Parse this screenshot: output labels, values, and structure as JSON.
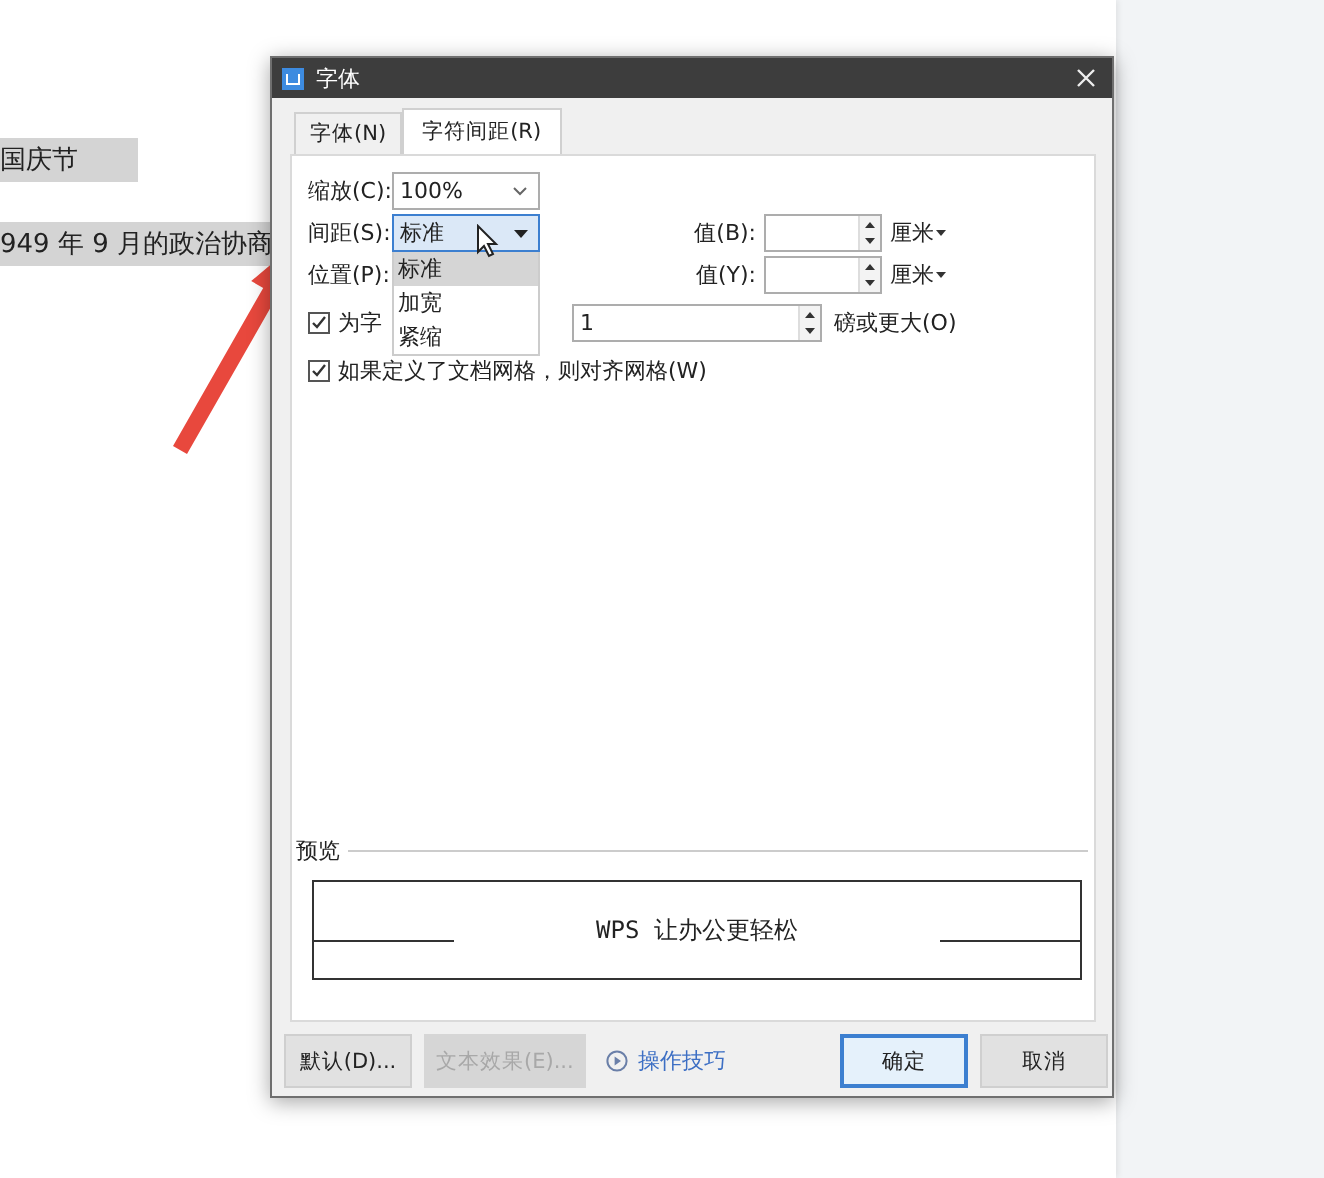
{
  "document": {
    "lines": [
      {
        "text": "国庆节",
        "highlighted": true
      },
      {
        "text": "949 年 9 月的政治协商",
        "highlighted": true
      }
    ]
  },
  "dialog": {
    "title": "字体",
    "tabs": [
      {
        "label": "字体(N)",
        "selected": false
      },
      {
        "label": "字符间距(R)",
        "selected": true
      }
    ],
    "scale": {
      "label": "缩放(C):",
      "value": "100%"
    },
    "spacing": {
      "label": "间距(S):",
      "value": "标准",
      "open": true,
      "value_label": "值(B):",
      "unit": "厘米",
      "options": [
        {
          "label": "标准",
          "selected": true
        },
        {
          "label": "加宽",
          "selected": false
        },
        {
          "label": "紧缩",
          "selected": false
        }
      ]
    },
    "position": {
      "label": "位置(P):",
      "value_label": "值(Y):",
      "unit": "厘米"
    },
    "kerning": {
      "label": "为字",
      "checked": true,
      "value": "1",
      "suffix": "磅或更大(O)"
    },
    "grid": {
      "label": "如果定义了文档网格，则对齐网格(W)",
      "checked": true
    },
    "preview": {
      "label": "预览",
      "sample": "WPS 让办公更轻松"
    },
    "buttons": [
      {
        "kind": "button",
        "label": "默认(D)...",
        "disabled": false,
        "focused": false
      },
      {
        "kind": "button",
        "label": "文本效果(E)...",
        "disabled": true,
        "focused": false
      },
      {
        "kind": "link",
        "label": "操作技巧"
      },
      {
        "kind": "button",
        "label": "确定",
        "disabled": false,
        "focused": true
      },
      {
        "kind": "button",
        "label": "取消",
        "disabled": false,
        "focused": false
      }
    ]
  }
}
